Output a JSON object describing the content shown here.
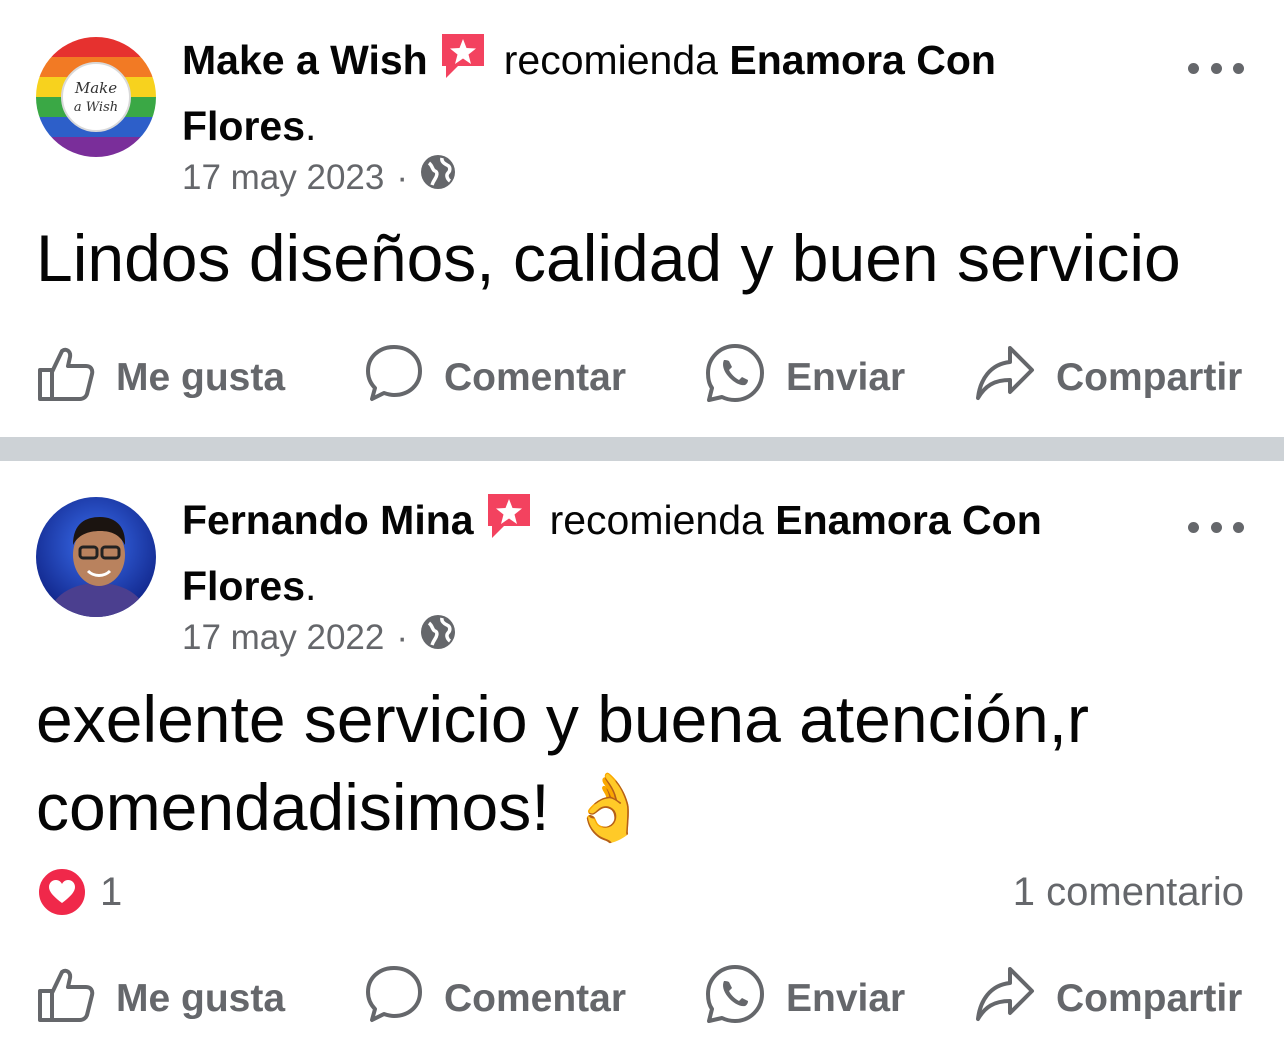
{
  "posts": [
    {
      "author": "Make a Wish",
      "recommends": "recomienda",
      "page": "Enamora Con",
      "page_line2": "Flores",
      "date": "17 may 2023",
      "separator": "·",
      "text": "Lindos diseños, calidad y buen servicio",
      "avatar_caption": "Make a Wish",
      "actions": {
        "like": "Me gusta",
        "comment": "Comentar",
        "send": "Enviar",
        "share": "Compartir"
      }
    },
    {
      "author": "Fernando Mina",
      "recommends": "recomienda",
      "page": "Enamora Con",
      "page_line2": "Flores",
      "date": "17 may 2022",
      "separator": "·",
      "text_line1": "exelente servicio y buena atención,r",
      "text_line2": "comendadisimos! 👌",
      "reactions_count": "1",
      "comments_count": "1 comentario",
      "actions": {
        "like": "Me gusta",
        "comment": "Comentar",
        "send": "Enviar",
        "share": "Compartir"
      }
    }
  ],
  "colors": {
    "recommend_icon": "#f3425f",
    "secondary_text": "#65676b",
    "divider": "#cdd2d6",
    "love": "#f0284a"
  },
  "icons": [
    "recommend-icon",
    "globe-icon",
    "more-icon",
    "like-icon",
    "comment-icon",
    "whatsapp-icon",
    "share-icon",
    "love-reaction-icon"
  ]
}
